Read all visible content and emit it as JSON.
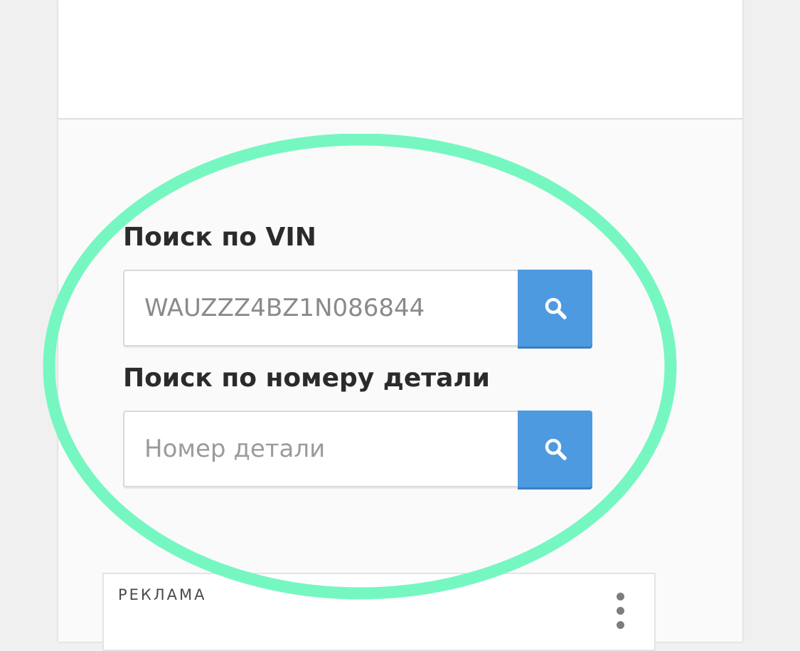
{
  "vin_search": {
    "title": "Поиск по VIN",
    "input_value": "WAUZZZ4BZ1N086844",
    "button_icon": "search-icon"
  },
  "part_search": {
    "title": "Поиск по номеру детали",
    "input_placeholder": "Номер детали",
    "button_icon": "search-icon"
  },
  "ad": {
    "label": "РЕКЛАМА",
    "menu_icon": "more-vertical-icon"
  },
  "colors": {
    "accent_button": "#4d9ae0",
    "highlight_ellipse": "#76f7c1"
  }
}
